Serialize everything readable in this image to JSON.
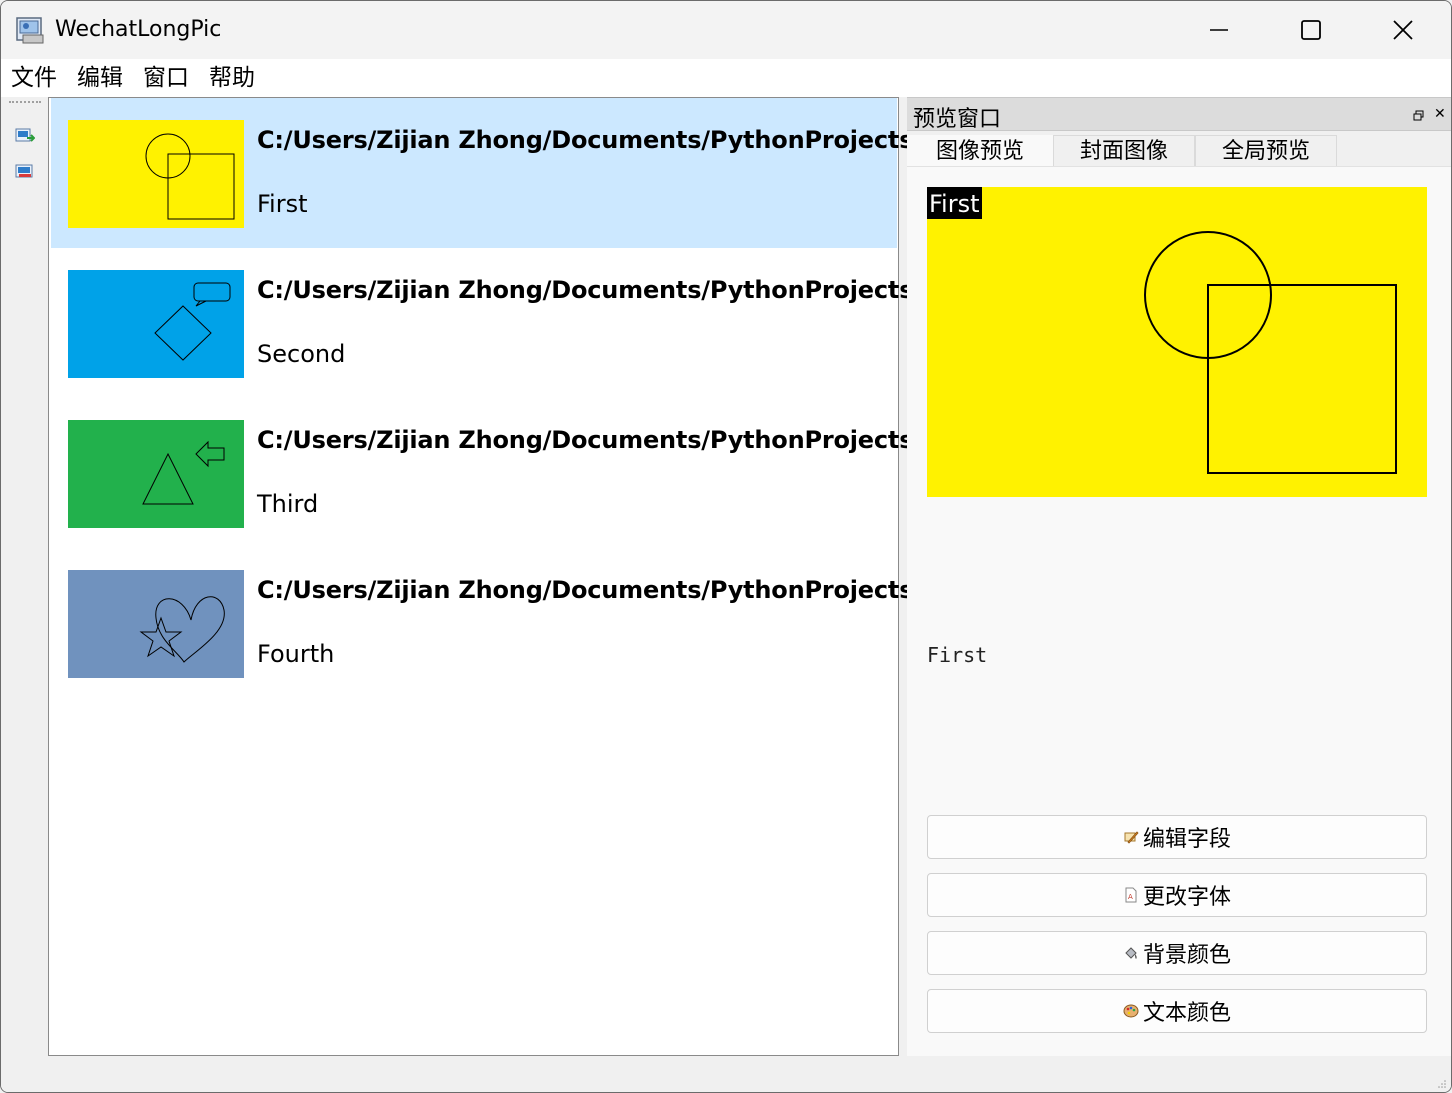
{
  "window": {
    "title": "WechatLongPic"
  },
  "menu": {
    "file": "文件",
    "edit": "编辑",
    "window": "窗口",
    "help": "帮助"
  },
  "toolbar": {
    "add_icon": "add-image-icon",
    "remove_icon": "remove-image-icon"
  },
  "list": {
    "items": [
      {
        "path": "C:/Users/Zijian Zhong/Documents/PythonProjects/",
        "name": "First",
        "color": "#fff200",
        "shape": "circle-square"
      },
      {
        "path": "C:/Users/Zijian Zhong/Documents/PythonProjects/",
        "name": "Second",
        "color": "#00a2e8",
        "shape": "diamond-callout"
      },
      {
        "path": "C:/Users/Zijian Zhong/Documents/PythonProjects/",
        "name": "Third",
        "color": "#22b14c",
        "shape": "triangle-arrow"
      },
      {
        "path": "C:/Users/Zijian Zhong/Documents/PythonProjects/",
        "name": "Fourth",
        "color": "#7092be",
        "shape": "heart-star"
      }
    ],
    "selected_index": 0,
    "selection_color": "#cce8ff"
  },
  "dock": {
    "title": "预览窗口",
    "tabs": [
      "图像预览",
      "封面图像",
      "全局预览"
    ],
    "active_tab": 0,
    "preview": {
      "label": "First",
      "caption": "First",
      "background": "#fff200"
    },
    "buttons": [
      {
        "label": "编辑字段",
        "icon": "edit-field-icon"
      },
      {
        "label": "更改字体",
        "icon": "font-file-icon"
      },
      {
        "label": "背景颜色",
        "icon": "paint-bucket-icon"
      },
      {
        "label": "文本颜色",
        "icon": "palette-icon"
      }
    ]
  }
}
